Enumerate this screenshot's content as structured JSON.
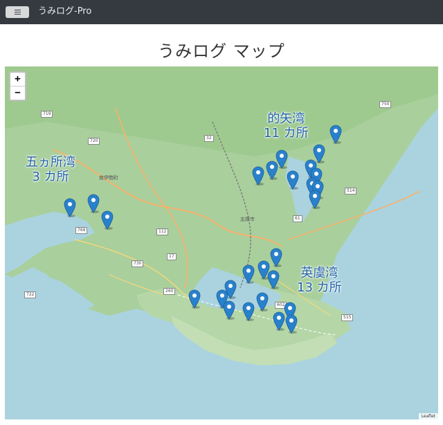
{
  "app": {
    "brand": "うみログ-Pro"
  },
  "page": {
    "title": "うみログ マップ"
  },
  "map": {
    "zoom_in": "+",
    "zoom_out": "−",
    "attribution": "Leaflet",
    "places": {
      "nanseicho": "南伊勢町",
      "shima": "志摩市"
    },
    "routes": [
      "719",
      "720",
      "32",
      "750",
      "514",
      "61",
      "769",
      "112",
      "730",
      "17",
      "722",
      "260",
      "602",
      "515"
    ],
    "colors": {
      "water": "#aad3df",
      "land": "#a9cf9d",
      "marker": "#2a81cb",
      "label": "#1f63a8"
    },
    "bays": [
      {
        "name": "的矢湾",
        "count": "11 カ所",
        "marker_count": 11
      },
      {
        "name": "五ヵ所湾",
        "count": "3 カ所",
        "marker_count": 3
      },
      {
        "name": "英虞湾",
        "count": "13 カ所",
        "marker_count": 13
      }
    ]
  }
}
